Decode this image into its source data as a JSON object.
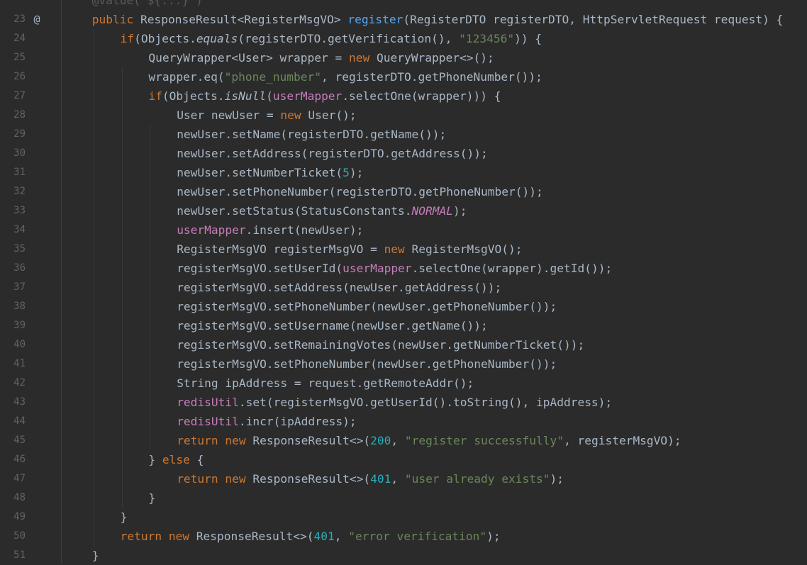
{
  "editor": {
    "colors": {
      "background": "#2b2b2b",
      "keyword": "#cc7832",
      "text": "#a9b7c6",
      "method": "#56a8f5",
      "string": "#6a8759",
      "number": "#2aacb8",
      "field": "#c77dbb"
    },
    "marker_icon": "override-at-icon",
    "lines": [
      {
        "num": "",
        "indent": 1,
        "tokens": [
          {
            "t": "@Value(\"${...}\")",
            "c": "faded"
          }
        ]
      },
      {
        "num": "23",
        "marker": "@",
        "indent": 1,
        "tokens": [
          {
            "t": "public ",
            "c": "kw"
          },
          {
            "t": "ResponseResult<RegisterMsgVO> ",
            "c": "plain"
          },
          {
            "t": "register",
            "c": "method"
          },
          {
            "t": "(RegisterDTO registerDTO, HttpServletRequest request) {",
            "c": "plain"
          }
        ]
      },
      {
        "num": "24",
        "indent": 2,
        "tokens": [
          {
            "t": "if",
            "c": "kw"
          },
          {
            "t": "(Objects.",
            "c": "plain"
          },
          {
            "t": "equals",
            "c": "static"
          },
          {
            "t": "(registerDTO.getVerification(), ",
            "c": "plain"
          },
          {
            "t": "\"123456\"",
            "c": "str"
          },
          {
            "t": ")) {",
            "c": "plain"
          }
        ]
      },
      {
        "num": "25",
        "indent": 3,
        "tokens": [
          {
            "t": "QueryWrapper<User> wrapper = ",
            "c": "plain"
          },
          {
            "t": "new ",
            "c": "kw"
          },
          {
            "t": "QueryWrapper<>();",
            "c": "plain"
          }
        ]
      },
      {
        "num": "26",
        "indent": 3,
        "tokens": [
          {
            "t": "wrapper.eq(",
            "c": "plain"
          },
          {
            "t": "\"phone_number\"",
            "c": "str"
          },
          {
            "t": ", registerDTO.getPhoneNumber());",
            "c": "plain"
          }
        ]
      },
      {
        "num": "27",
        "indent": 3,
        "tokens": [
          {
            "t": "if",
            "c": "kw"
          },
          {
            "t": "(Objects.",
            "c": "plain"
          },
          {
            "t": "isNull",
            "c": "static"
          },
          {
            "t": "(",
            "c": "plain"
          },
          {
            "t": "userMapper",
            "c": "field"
          },
          {
            "t": ".selectOne(wrapper))) {",
            "c": "plain"
          }
        ]
      },
      {
        "num": "28",
        "indent": 4,
        "tokens": [
          {
            "t": "User newUser = ",
            "c": "plain"
          },
          {
            "t": "new ",
            "c": "kw"
          },
          {
            "t": "User();",
            "c": "plain"
          }
        ]
      },
      {
        "num": "29",
        "indent": 4,
        "tokens": [
          {
            "t": "newUser.setName(registerDTO.getName());",
            "c": "plain"
          }
        ]
      },
      {
        "num": "30",
        "indent": 4,
        "tokens": [
          {
            "t": "newUser.setAddress(registerDTO.getAddress());",
            "c": "plain"
          }
        ]
      },
      {
        "num": "31",
        "indent": 4,
        "tokens": [
          {
            "t": "newUser.setNumberTicket(",
            "c": "plain"
          },
          {
            "t": "5",
            "c": "num"
          },
          {
            "t": ");",
            "c": "plain"
          }
        ]
      },
      {
        "num": "32",
        "indent": 4,
        "tokens": [
          {
            "t": "newUser.setPhoneNumber(registerDTO.getPhoneNumber());",
            "c": "plain"
          }
        ]
      },
      {
        "num": "33",
        "indent": 4,
        "tokens": [
          {
            "t": "newUser.setStatus(StatusConstants.",
            "c": "plain"
          },
          {
            "t": "NORMAL",
            "c": "const"
          },
          {
            "t": ");",
            "c": "plain"
          }
        ]
      },
      {
        "num": "34",
        "indent": 4,
        "tokens": [
          {
            "t": "userMapper",
            "c": "field"
          },
          {
            "t": ".insert(newUser);",
            "c": "plain"
          }
        ]
      },
      {
        "num": "35",
        "indent": 4,
        "tokens": [
          {
            "t": "RegisterMsgVO registerMsgVO = ",
            "c": "plain"
          },
          {
            "t": "new ",
            "c": "kw"
          },
          {
            "t": "RegisterMsgVO();",
            "c": "plain"
          }
        ]
      },
      {
        "num": "36",
        "indent": 4,
        "tokens": [
          {
            "t": "registerMsgVO.setUserId(",
            "c": "plain"
          },
          {
            "t": "userMapper",
            "c": "field"
          },
          {
            "t": ".selectOne(wrapper).getId());",
            "c": "plain"
          }
        ]
      },
      {
        "num": "37",
        "indent": 4,
        "tokens": [
          {
            "t": "registerMsgVO.setAddress(newUser.getAddress());",
            "c": "plain"
          }
        ]
      },
      {
        "num": "38",
        "indent": 4,
        "tokens": [
          {
            "t": "registerMsgVO.setPhoneNumber(newUser.getPhoneNumber());",
            "c": "plain"
          }
        ]
      },
      {
        "num": "39",
        "indent": 4,
        "tokens": [
          {
            "t": "registerMsgVO.setUsername(newUser.getName());",
            "c": "plain"
          }
        ]
      },
      {
        "num": "40",
        "indent": 4,
        "tokens": [
          {
            "t": "registerMsgVO.setRemainingVotes(newUser.getNumberTicket());",
            "c": "plain"
          }
        ]
      },
      {
        "num": "41",
        "indent": 4,
        "tokens": [
          {
            "t": "registerMsgVO.setPhoneNumber(newUser.getPhoneNumber());",
            "c": "plain"
          }
        ]
      },
      {
        "num": "42",
        "indent": 4,
        "tokens": [
          {
            "t": "String ipAddress = request.getRemoteAddr();",
            "c": "plain"
          }
        ]
      },
      {
        "num": "43",
        "indent": 4,
        "tokens": [
          {
            "t": "redisUtil",
            "c": "field"
          },
          {
            "t": ".set(registerMsgVO.getUserId().toString(), ipAddress);",
            "c": "plain"
          }
        ]
      },
      {
        "num": "44",
        "indent": 4,
        "tokens": [
          {
            "t": "redisUtil",
            "c": "field"
          },
          {
            "t": ".incr(ipAddress);",
            "c": "plain"
          }
        ]
      },
      {
        "num": "45",
        "indent": 4,
        "tokens": [
          {
            "t": "return new ",
            "c": "kw"
          },
          {
            "t": "ResponseResult<>(",
            "c": "plain"
          },
          {
            "t": "200",
            "c": "num"
          },
          {
            "t": ", ",
            "c": "plain"
          },
          {
            "t": "\"register successfully\"",
            "c": "str"
          },
          {
            "t": ", registerMsgVO);",
            "c": "plain"
          }
        ]
      },
      {
        "num": "46",
        "indent": 3,
        "tokens": [
          {
            "t": "} ",
            "c": "plain"
          },
          {
            "t": "else ",
            "c": "kw"
          },
          {
            "t": "{",
            "c": "plain"
          }
        ]
      },
      {
        "num": "47",
        "indent": 4,
        "tokens": [
          {
            "t": "return new ",
            "c": "kw"
          },
          {
            "t": "ResponseResult<>(",
            "c": "plain"
          },
          {
            "t": "401",
            "c": "num"
          },
          {
            "t": ", ",
            "c": "plain"
          },
          {
            "t": "\"user already exists\"",
            "c": "str"
          },
          {
            "t": ");",
            "c": "plain"
          }
        ]
      },
      {
        "num": "48",
        "indent": 3,
        "tokens": [
          {
            "t": "}",
            "c": "plain"
          }
        ]
      },
      {
        "num": "49",
        "indent": 2,
        "tokens": [
          {
            "t": "}",
            "c": "plain"
          }
        ]
      },
      {
        "num": "50",
        "indent": 2,
        "tokens": [
          {
            "t": "return new ",
            "c": "kw"
          },
          {
            "t": "ResponseResult<>(",
            "c": "plain"
          },
          {
            "t": "401",
            "c": "num"
          },
          {
            "t": ", ",
            "c": "plain"
          },
          {
            "t": "\"error verification\"",
            "c": "str"
          },
          {
            "t": ");",
            "c": "plain"
          }
        ]
      },
      {
        "num": "51",
        "indent": 1,
        "tokens": [
          {
            "t": "}",
            "c": "plain"
          }
        ]
      }
    ]
  }
}
